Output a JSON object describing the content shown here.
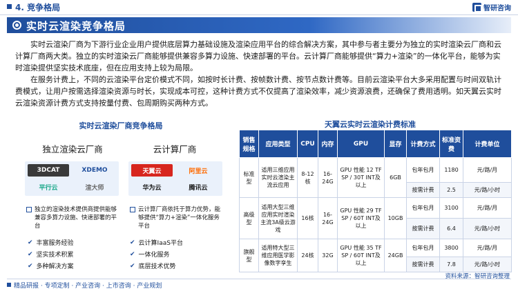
{
  "header": {
    "section": "4. 竞争格局",
    "logo_text": "智研咨询"
  },
  "banner": {
    "title": "实时云渲染竞争格局"
  },
  "intro": {
    "p1": "实时云渲染厂商为下游行业企业用户提供底层算力基础设施及渲染应用平台的综合解决方案，其中参与者主要分为独立的实时渲染云厂商和云计算厂商两大类。独立的实时渲染云厂商能够提供兼容多算力设施、快速部署的平台。云计算厂商能够提供“算力+渲染”的一体化平台，能够为实时渲染提供坚实技术底座，但在应用支持上较为局限。",
    "p2": "在服务计费上，不同的云渲染平台定价模式不同，如按时长计费、按帧数计费、按节点数计费等。目前云渲染平台大多采用配置与时间双轨计费模式，让用户按需选择渲染资源与时长，实现成本可控，这种计费方式不仅提高了渲染效率，减少资源浪费，还确保了费用透明。如天翼云实时云渲染资源计费方式支持按量付费、包周期购买两种方式。"
  },
  "left": {
    "title": "实时云渲染厂商竞争格局",
    "independent": {
      "heading": "独立渲染云厂商",
      "logos": [
        "3DCAT",
        "XDEMO",
        "平行云",
        "渲大师"
      ],
      "desc": "独立的渲染技术提供商提供能够兼容多算力设施、快速部署的平台",
      "points": [
        "丰富服务经验",
        "坚实技术积累",
        "多种解决方案"
      ]
    },
    "cloud": {
      "heading": "云计算厂商",
      "logos": [
        "天翼云",
        "阿里云",
        "华为云",
        "腾讯云"
      ],
      "desc": "云计算厂商依托于算力优势，能够提供“算力+渲染”一体化服务平台",
      "points": [
        "云计算IaaS平台",
        "一体化服务",
        "底层技术优势"
      ]
    }
  },
  "right": {
    "title": "天翼云实时云渲染计费标准",
    "headers": [
      "销售规格",
      "应用类型",
      "CPU",
      "内存",
      "GPU",
      "显存",
      "计费方式",
      "标准资费",
      "计费单位"
    ],
    "rows": [
      {
        "spec": "标准型",
        "app": "适用三维应用实时云渲染主流云应用",
        "cpu": "8-12核",
        "mem": "16-24G",
        "gpu": "GPU 性能 12 TF SP / 30T INT及以上",
        "vram": "6GB",
        "billing": [
          {
            "method": "包年包月",
            "price": "1180",
            "unit": "元/路/月"
          },
          {
            "method": "按需计费",
            "price": "2.5",
            "unit": "元/路/小时"
          }
        ]
      },
      {
        "spec": "高级型",
        "app": "适用大型三维应用实时渲染主流3A级云游戏",
        "cpu": "16核",
        "mem": "16-24G",
        "gpu": "GPU 性能 29 TF SP / 60T INT及以上",
        "vram": "10GB",
        "billing": [
          {
            "method": "包年包月",
            "price": "3100",
            "unit": "元/路/月"
          },
          {
            "method": "按需计费",
            "price": "6.4",
            "unit": "元/路/小时"
          }
        ]
      },
      {
        "spec": "旗舰型",
        "app": "适用特大型三维应用医学影像数字孪生",
        "cpu": "24核",
        "mem": "32G",
        "gpu": "GPU 性能 35 TF SP / 60T INT及以上",
        "vram": "24GB",
        "billing": [
          {
            "method": "包年包月",
            "price": "3800",
            "unit": "元/路/月"
          },
          {
            "method": "按需计费",
            "price": "7.8",
            "unit": "元/路/小时"
          }
        ]
      }
    ]
  },
  "footer": {
    "text": "精品研报 · 专项定制 · 产业咨询 · 上市咨询 · 产业规划",
    "source": "资料来源：智研咨询整理"
  }
}
